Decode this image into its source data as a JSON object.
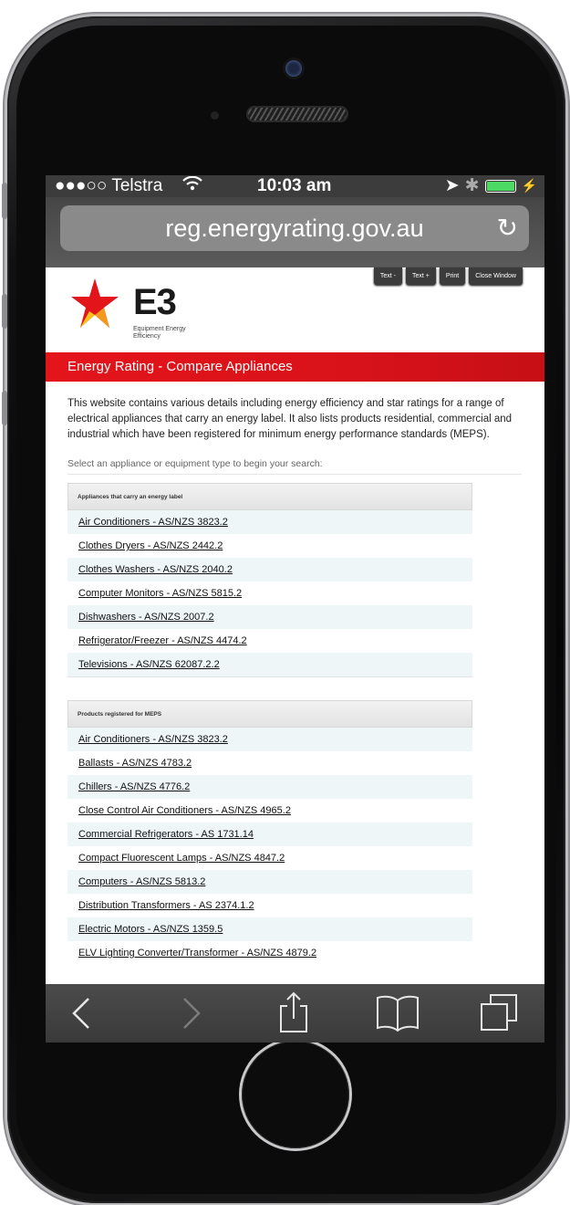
{
  "statusbar": {
    "carrier": "●●●○○ Telstra",
    "wifi": "wifi-icon",
    "time": "10:03 am"
  },
  "browser": {
    "url": "reg.energyrating.gov.au"
  },
  "toolbar_buttons": [
    "Text -",
    "Text +",
    "Print",
    "Close Window"
  ],
  "logo": {
    "mark": "E3",
    "subtitle": "Equipment Energy Efficiency"
  },
  "banner": {
    "title": "Energy Rating - Compare Appliances"
  },
  "intro": "This website contains various details including energy efficiency and star ratings for a range of electrical appliances that carry an energy label. It also lists products residential, commercial and industrial which have been registered for minimum energy performance standards (MEPS).",
  "prompt": "Select an appliance or equipment type to begin your search:",
  "sections": [
    {
      "title": "Appliances that carry an energy label",
      "items": [
        "Air Conditioners - AS/NZS 3823.2",
        "Clothes Dryers - AS/NZS 2442.2",
        "Clothes Washers - AS/NZS 2040.2",
        "Computer Monitors - AS/NZS 5815.2",
        "Dishwashers - AS/NZS 2007.2",
        "Refrigerator/Freezer - AS/NZS 4474.2",
        "Televisions - AS/NZS 62087.2.2"
      ]
    },
    {
      "title": "Products registered for MEPS",
      "items": [
        "Air Conditioners - AS/NZS 3823.2",
        "Ballasts - AS/NZS 4783.2",
        "Chillers - AS/NZS 4776.2",
        "Close Control Air Conditioners - AS/NZS 4965.2",
        "Commercial Refrigerators - AS 1731.14",
        "Compact Fluorescent Lamps - AS/NZS 4847.2",
        "Computers - AS/NZS 5813.2",
        "Distribution Transformers - AS 2374.1.2",
        "Electric Motors - AS/NZS 1359.5",
        "ELV Lighting Converter/Transformer - AS/NZS 4879.2"
      ]
    }
  ],
  "bottom_icons": [
    "back-icon",
    "forward-icon",
    "share-icon",
    "bookmarks-icon",
    "tabs-icon"
  ],
  "colors": {
    "banner": "#e4141b",
    "row_alt": "#eef6f7",
    "battery": "#4cd964"
  }
}
